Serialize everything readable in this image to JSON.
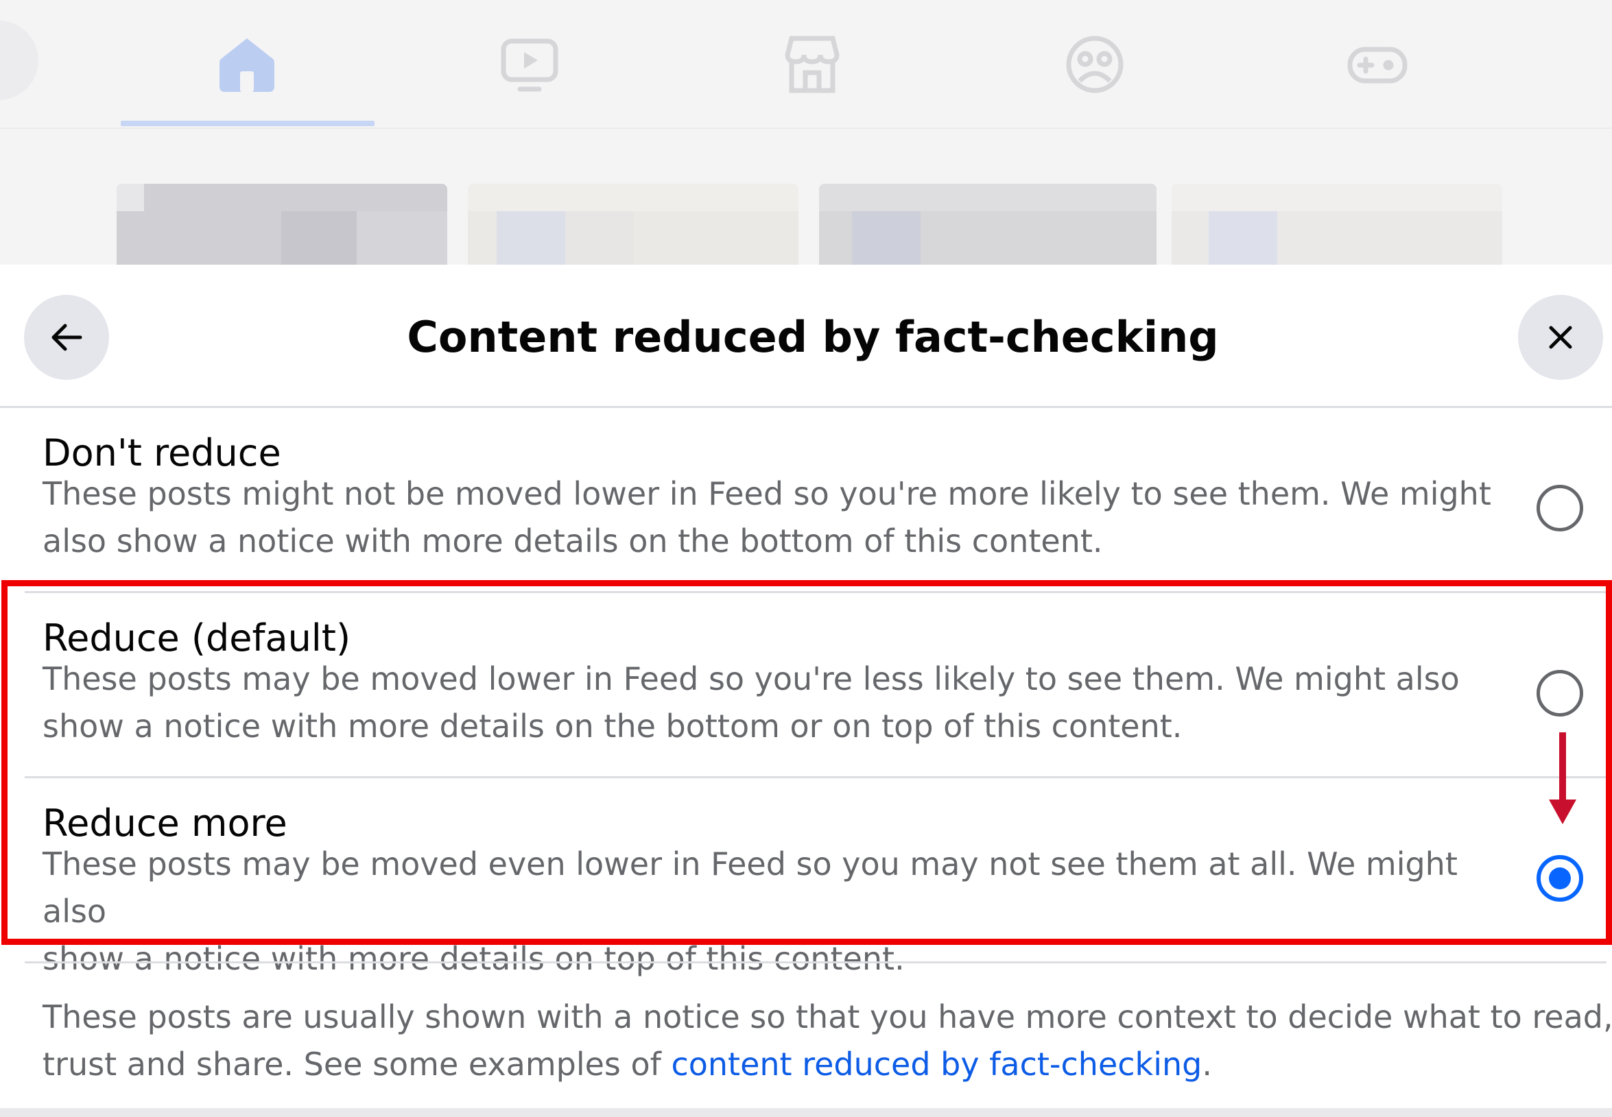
{
  "background_nav": {
    "tabs": [
      {
        "icon": "home-icon",
        "active": true
      },
      {
        "icon": "video-icon",
        "active": false
      },
      {
        "icon": "marketplace-icon",
        "active": false
      },
      {
        "icon": "groups-icon",
        "active": false
      },
      {
        "icon": "gaming-icon",
        "active": false
      }
    ]
  },
  "sheet": {
    "back_icon": "arrow-left-icon",
    "close_icon": "close-icon",
    "title": "Content reduced by fact-checking",
    "options": [
      {
        "title": "Don't reduce",
        "description": "These posts might not be moved lower in Feed so you're more likely to see them. We might\nalso show a notice with more details on the bottom of this content.",
        "selected": false
      },
      {
        "title": "Reduce (default)",
        "description": "These posts may be moved lower in Feed so you're less likely to see them. We might also\nshow a notice with more details on the bottom or on top of this content.",
        "selected": false
      },
      {
        "title": "Reduce more",
        "description": "These posts may be moved even lower in Feed so you may not see them at all. We might also\nshow a notice with more details on top of this content.",
        "selected": true
      }
    ],
    "footer": {
      "text_before": "These posts are usually shown with a notice so that you have more context to decide what to read,\ntrust and share. See some examples of ",
      "link_text": "content reduced by fact-checking",
      "text_after": "."
    }
  },
  "colors": {
    "accent": "#0866ff",
    "link": "#0d5ce6",
    "annotation_box": "#ee0000",
    "annotation_arrow": "#c8102e",
    "secondary_text": "#65676b"
  }
}
